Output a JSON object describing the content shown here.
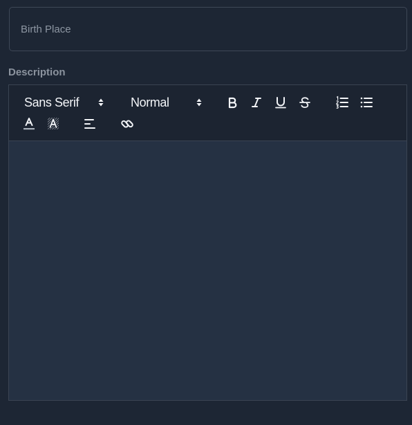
{
  "birth_place": {
    "placeholder": "Birth Place",
    "value": ""
  },
  "description": {
    "label": "Description",
    "body_text": ""
  },
  "toolbar": {
    "font_picker": {
      "selected": "Sans Serif",
      "icon": "updown-arrows-icon"
    },
    "size_picker": {
      "selected": "Normal",
      "icon": "updown-arrows-icon"
    },
    "buttons": [
      {
        "name": "bold",
        "icon": "bold-icon"
      },
      {
        "name": "italic",
        "icon": "italic-icon"
      },
      {
        "name": "underline",
        "icon": "underline-icon"
      },
      {
        "name": "strike",
        "icon": "strikethrough-icon"
      },
      {
        "name": "ordered-list",
        "icon": "ordered-list-icon"
      },
      {
        "name": "bullet-list",
        "icon": "bullet-list-icon"
      },
      {
        "name": "text-color",
        "icon": "text-color-icon"
      },
      {
        "name": "background-color",
        "icon": "background-color-icon"
      },
      {
        "name": "align",
        "icon": "align-left-icon"
      },
      {
        "name": "link",
        "icon": "link-icon"
      }
    ]
  },
  "colors": {
    "page_background": "#1d2634",
    "toolbar_background": "#1c2431",
    "editor_background": "#253143",
    "border": "#3a4452",
    "icon": "#f3f5f8",
    "placeholder": "#8d96a2",
    "label": "#8b939e"
  }
}
